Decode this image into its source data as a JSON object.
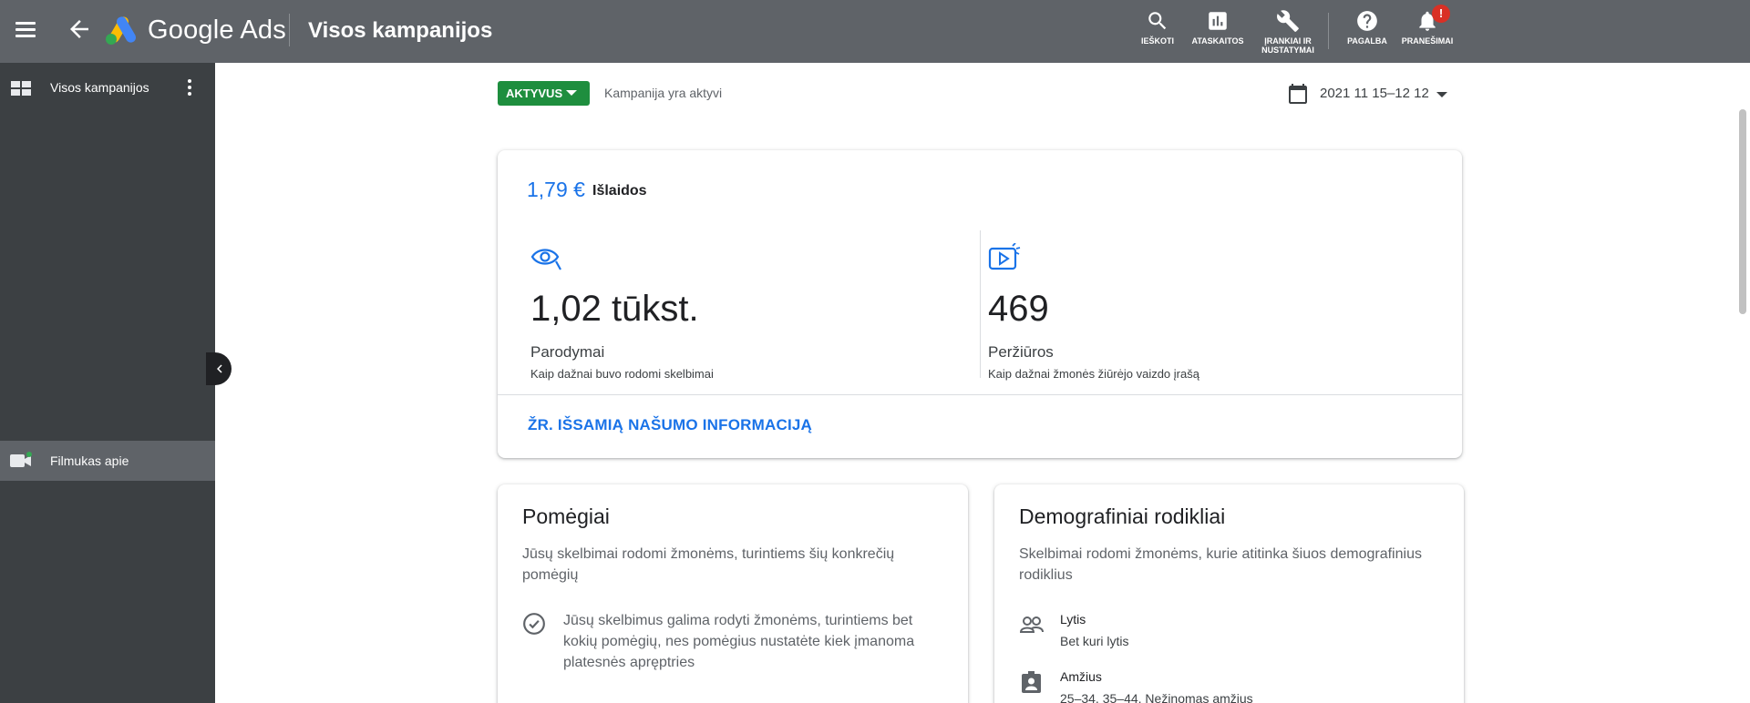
{
  "header": {
    "brand": "Google Ads",
    "title": "Visos kampanijos",
    "tools": [
      {
        "label": "IEŠKOTI",
        "icon": "search-icon"
      },
      {
        "label": "ATASKAITOS",
        "icon": "reports-icon"
      },
      {
        "label_line1": "ĮRANKIAI IR",
        "label_line2": "NUSTATYMAI",
        "icon": "wrench-icon"
      },
      {
        "label": "PAGALBA",
        "icon": "help-icon"
      },
      {
        "label": "PRANEŠIMAI",
        "icon": "bell-icon",
        "badge": "!"
      }
    ]
  },
  "sidebar": {
    "items": [
      {
        "label": "Visos kampanijos",
        "icon": "grid-icon"
      },
      {
        "label": "Filmukas apie",
        "icon": "video-camera-icon",
        "selected": true
      }
    ]
  },
  "campaign": {
    "status": "AKTYVUS",
    "status_text": "Kampanija yra aktyvi",
    "date_range": "2021 11 15–12 12"
  },
  "performance": {
    "cost_value": "1,79 €",
    "cost_label": "Išlaidos",
    "metrics": [
      {
        "value": "1,02 tūkst.",
        "name": "Parodymai",
        "desc": "Kaip dažnai buvo rodomi skelbimai",
        "icon": "eye-icon"
      },
      {
        "value": "469",
        "name": "Peržiūros",
        "desc": "Kaip dažnai žmonės žiūrėjo vaizdo įrašą",
        "icon": "video-play-icon"
      }
    ],
    "more_link": "ŽR. IŠSAMIĄ NAŠUMO INFORMACIJĄ"
  },
  "interests": {
    "title": "Pomėgiai",
    "description": "Jūsų skelbimai rodomi žmonėms, turintiems šių konkrečių pomėgių",
    "item": "Jūsų skelbimus galima rodyti žmonėms, turintiems bet kokių pomėgių, nes pomėgius nustatėte kiek įmanoma platesnės apręptries"
  },
  "demographics": {
    "title": "Demografiniai rodikliai",
    "description": "Skelbimai rodomi žmonėms, kurie atitinka šiuos demografinius rodiklius",
    "items": [
      {
        "label": "Lytis",
        "value": "Bet kuri lytis",
        "icon": "people-icon"
      },
      {
        "label": "Amžius",
        "value": "25–34, 35–44, Nežinomas amžius",
        "icon": "age-badge-icon"
      }
    ]
  },
  "colors": {
    "topbar": "#5f6368",
    "sidebar": "#3c4043",
    "accent": "#1a73e8",
    "status_green": "#1e8e3e",
    "badge_red": "#d93025"
  }
}
